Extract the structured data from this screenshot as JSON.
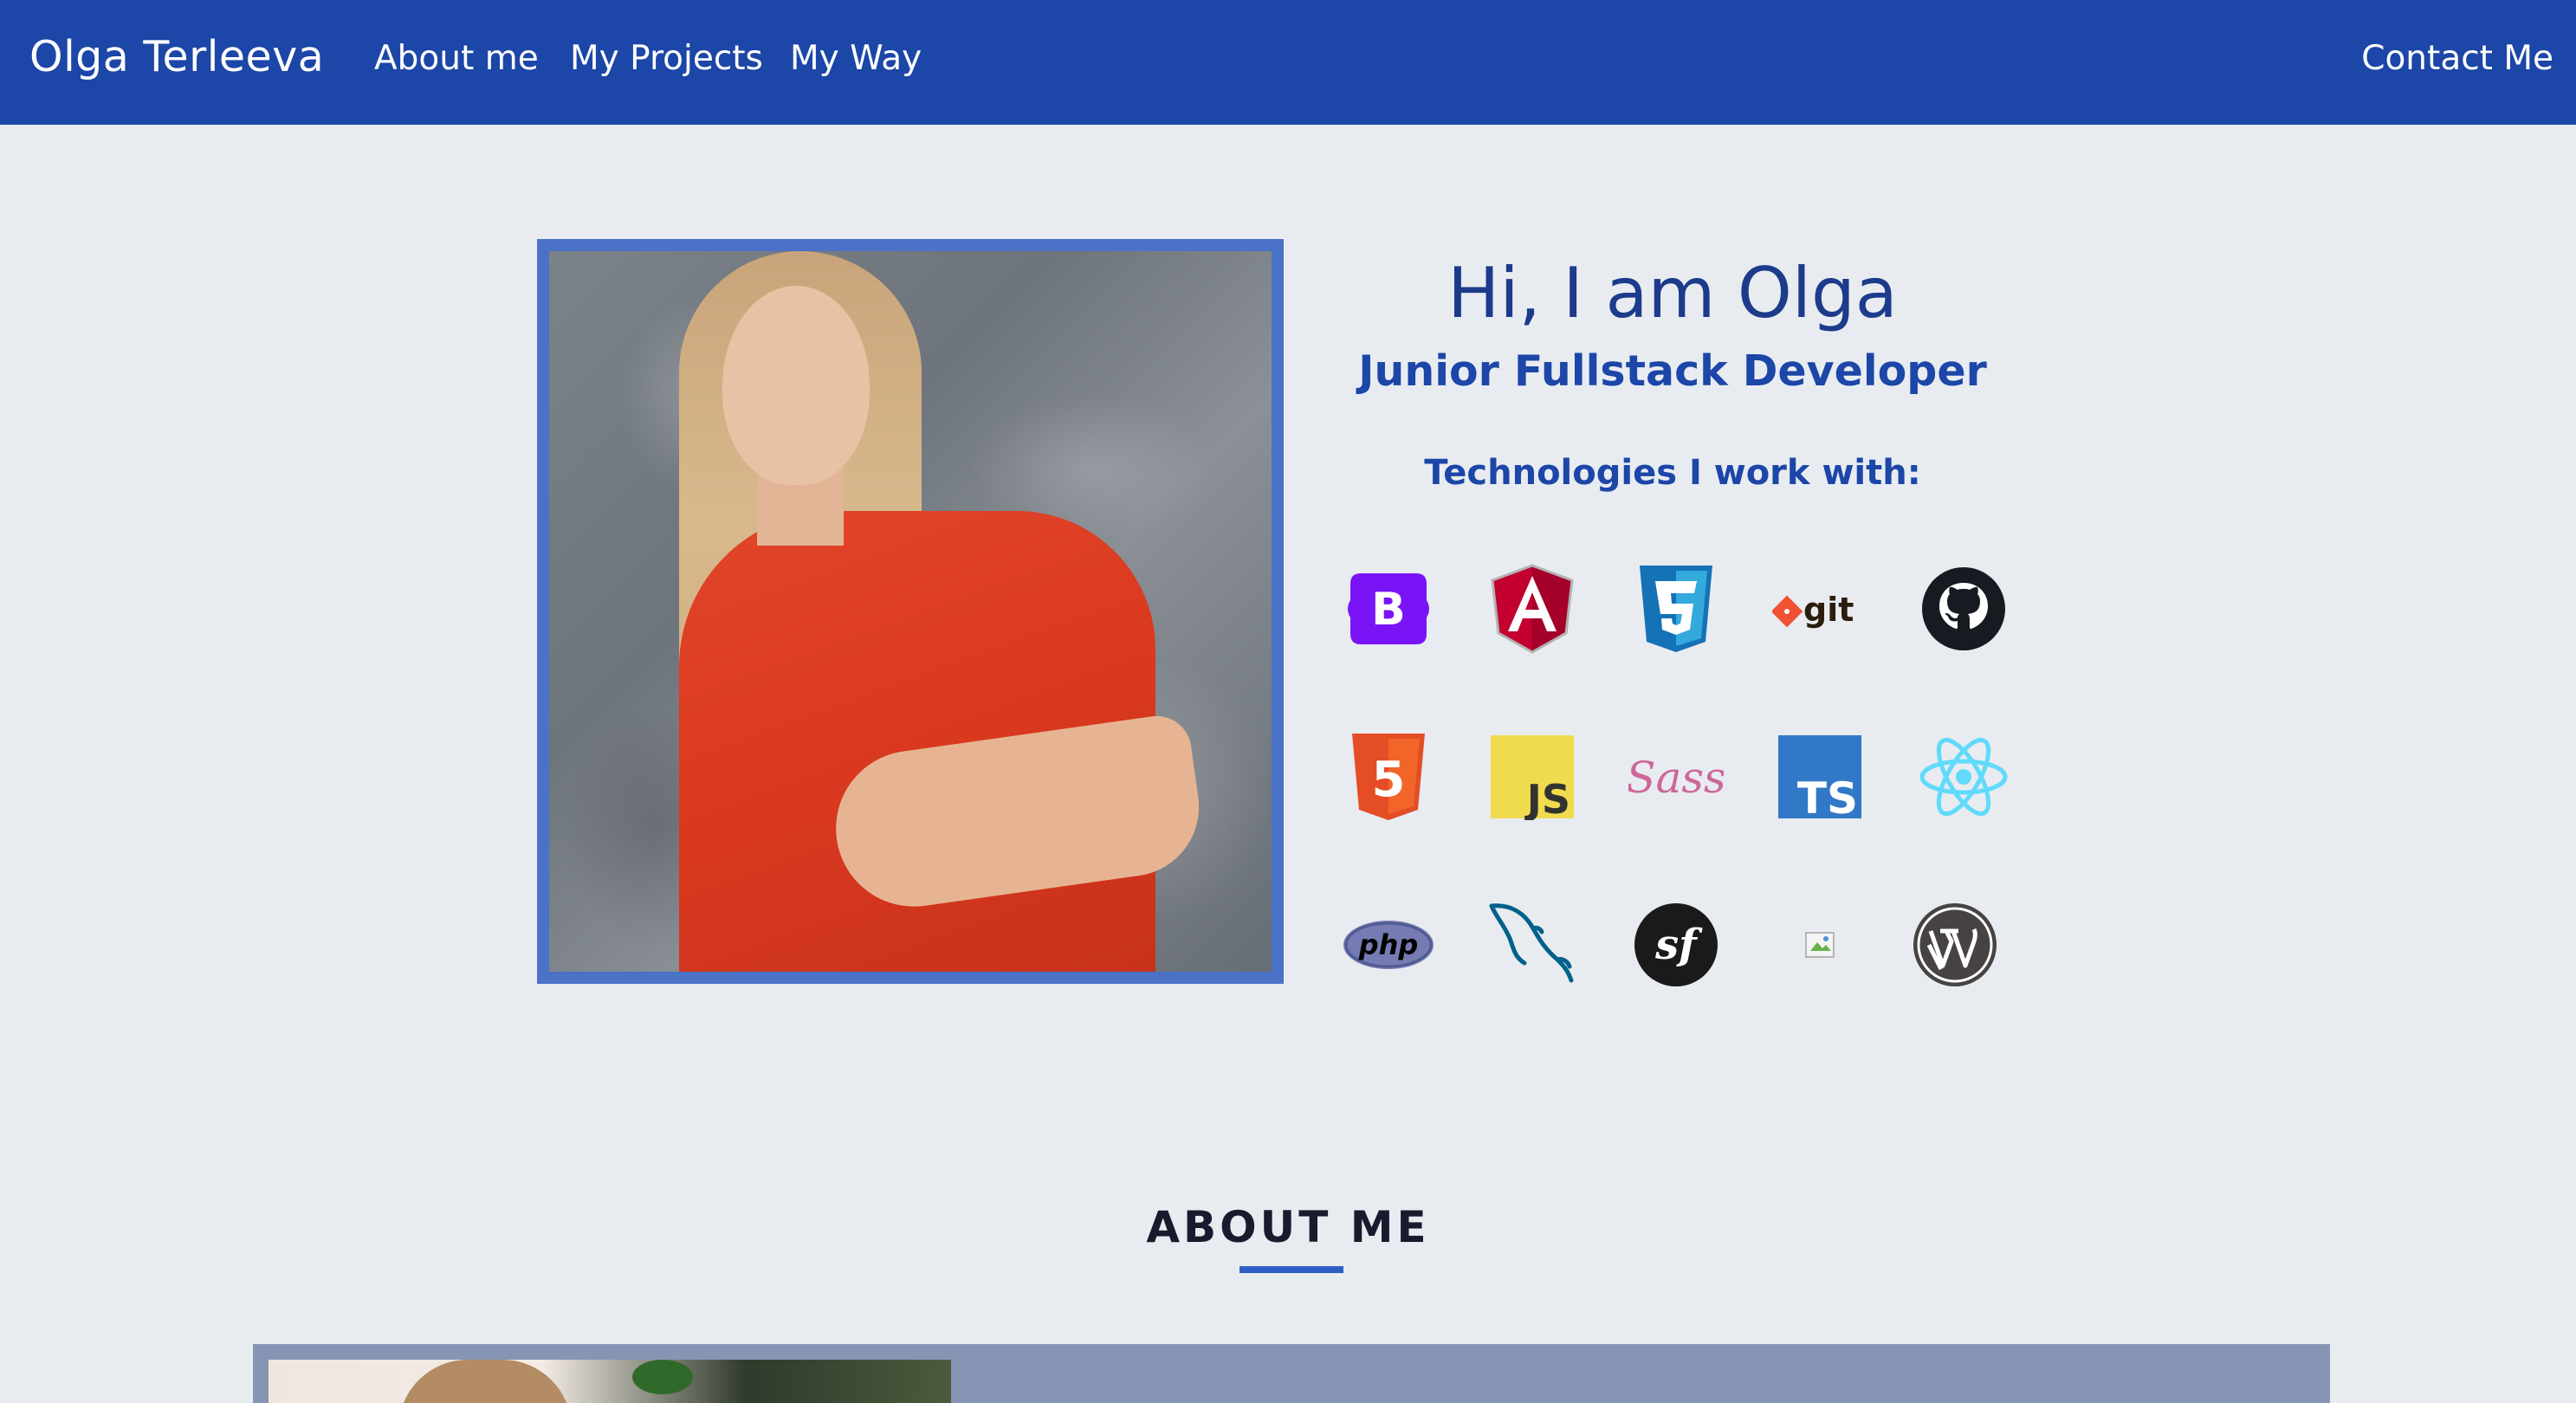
{
  "navbar": {
    "brand": "Olga Terleeva",
    "links": [
      {
        "label": "About me"
      },
      {
        "label": "My Projects"
      },
      {
        "label": "My Way"
      }
    ],
    "contact_label": "Contact Me",
    "background_color": "#1c46a7"
  },
  "hero": {
    "title": "Hi, I am Olga",
    "subtitle": "Junior Fullstack Developer",
    "tech_heading": "Technologies I work with:",
    "technologies": [
      {
        "icon": "bootstrap-icon"
      },
      {
        "icon": "angular-icon"
      },
      {
        "icon": "css3-icon"
      },
      {
        "icon": "git-icon",
        "text": "git"
      },
      {
        "icon": "github-icon"
      },
      {
        "icon": "html5-icon",
        "text": "5"
      },
      {
        "icon": "javascript-icon",
        "text": "JS"
      },
      {
        "icon": "sass-icon",
        "text": "Sass"
      },
      {
        "icon": "typescript-icon",
        "text": "TS"
      },
      {
        "icon": "react-icon"
      },
      {
        "icon": "php-icon",
        "text": "php"
      },
      {
        "icon": "mysql-icon"
      },
      {
        "icon": "symfony-icon",
        "text": "sf"
      },
      {
        "icon": "broken-image-icon"
      },
      {
        "icon": "wordpress-icon"
      }
    ]
  },
  "about": {
    "title": "ABOUT ME"
  },
  "colors": {
    "accent": "#1c46a7",
    "page_background": "#e8ecf1",
    "photo_frame": "#4a72c6",
    "card_background": "#8695b4"
  }
}
